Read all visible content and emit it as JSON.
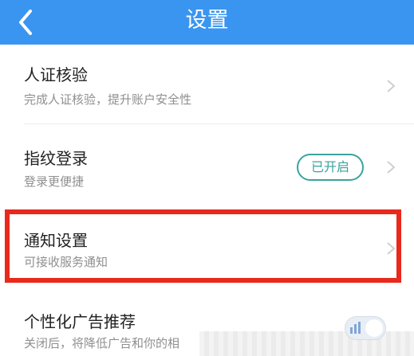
{
  "header": {
    "title": "设置",
    "back_icon": "chevron-left-icon"
  },
  "rows": [
    {
      "title": "人证核验",
      "subtitle": "完成人证核验，提升账户安全性"
    },
    {
      "title": "指纹登录",
      "subtitle": "登录更便捷",
      "badge": "已开启"
    },
    {
      "title": "通知设置",
      "subtitle": "可接收服务通知"
    },
    {
      "title": "个性化广告推荐",
      "subtitle": "关闭后，将降低广告和你的相"
    }
  ],
  "colors": {
    "accent": "#3A95F0",
    "highlight": "#E8291C",
    "badge": "#3AA39D"
  }
}
